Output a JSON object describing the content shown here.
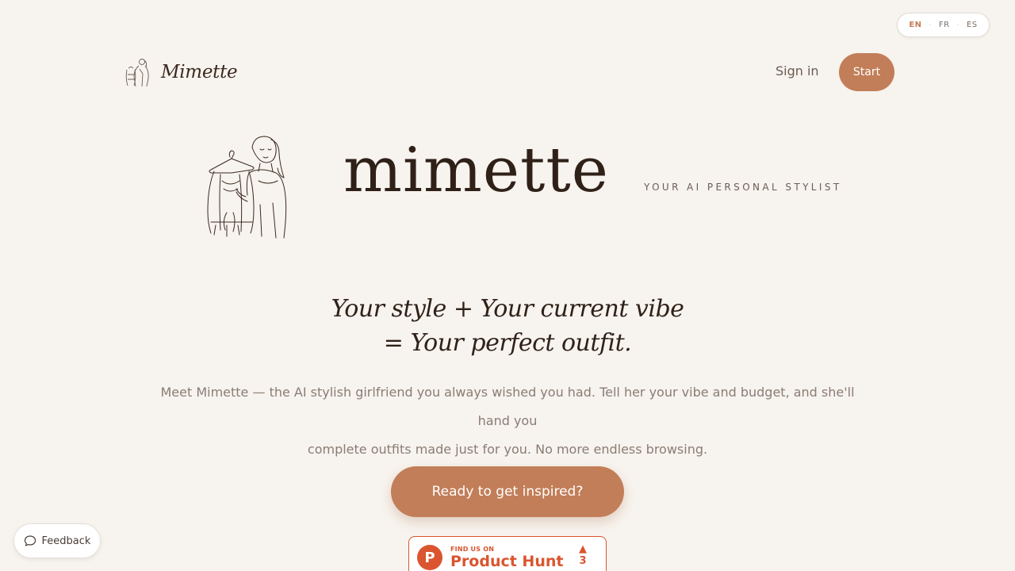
{
  "language_switch": {
    "options": [
      "EN",
      "FR",
      "ES"
    ],
    "selected": "EN"
  },
  "brand": {
    "name": "Mimette"
  },
  "nav": {
    "signin_label": "Sign in",
    "start_label": "Start"
  },
  "hero": {
    "wordmark": "mimette",
    "tagline": "YOUR AI PERSONAL STYLIST",
    "headline_line1": "Your style + Your current vibe",
    "headline_line2": "= Your perfect outfit.",
    "intro_line1": "Meet Mimette — the AI stylish girlfriend you always wished you had. Tell her your vibe and budget, and she'll hand you",
    "intro_line2": "complete outfits made just for you. No more endless browsing.",
    "cta_label": "Ready to get inspired?"
  },
  "product_hunt": {
    "small_label": "FIND US ON",
    "big_label": "Product Hunt",
    "votes": "3",
    "logo_letter": "P"
  },
  "feedback": {
    "label": "Feedback"
  },
  "colors": {
    "background": "#f7f3ee",
    "accent": "#c27e58",
    "product_hunt": "#da552f",
    "text_dark": "#2f2118"
  }
}
